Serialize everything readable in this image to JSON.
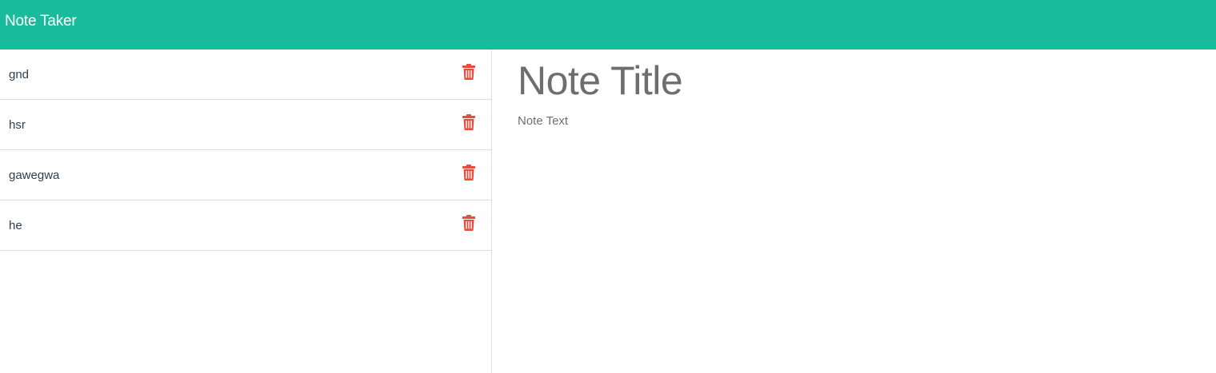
{
  "header": {
    "title": "Note Taker"
  },
  "sidebar": {
    "items": [
      {
        "label": "gnd",
        "delete_icon": "trash-icon"
      },
      {
        "label": "hsr",
        "delete_icon": "trash-icon"
      },
      {
        "label": "gawegwa",
        "delete_icon": "trash-icon"
      },
      {
        "label": "he",
        "delete_icon": "trash-icon"
      }
    ]
  },
  "editor": {
    "title_placeholder": "Note Title",
    "title_value": "",
    "text_placeholder": "Note Text",
    "text_value": ""
  },
  "colors": {
    "accent": "#18bc9c",
    "delete_icon": "#e74c3c",
    "divider": "#dddddd",
    "placeholder_text": "#6e6e6e",
    "body_text": "#2c3e50"
  }
}
